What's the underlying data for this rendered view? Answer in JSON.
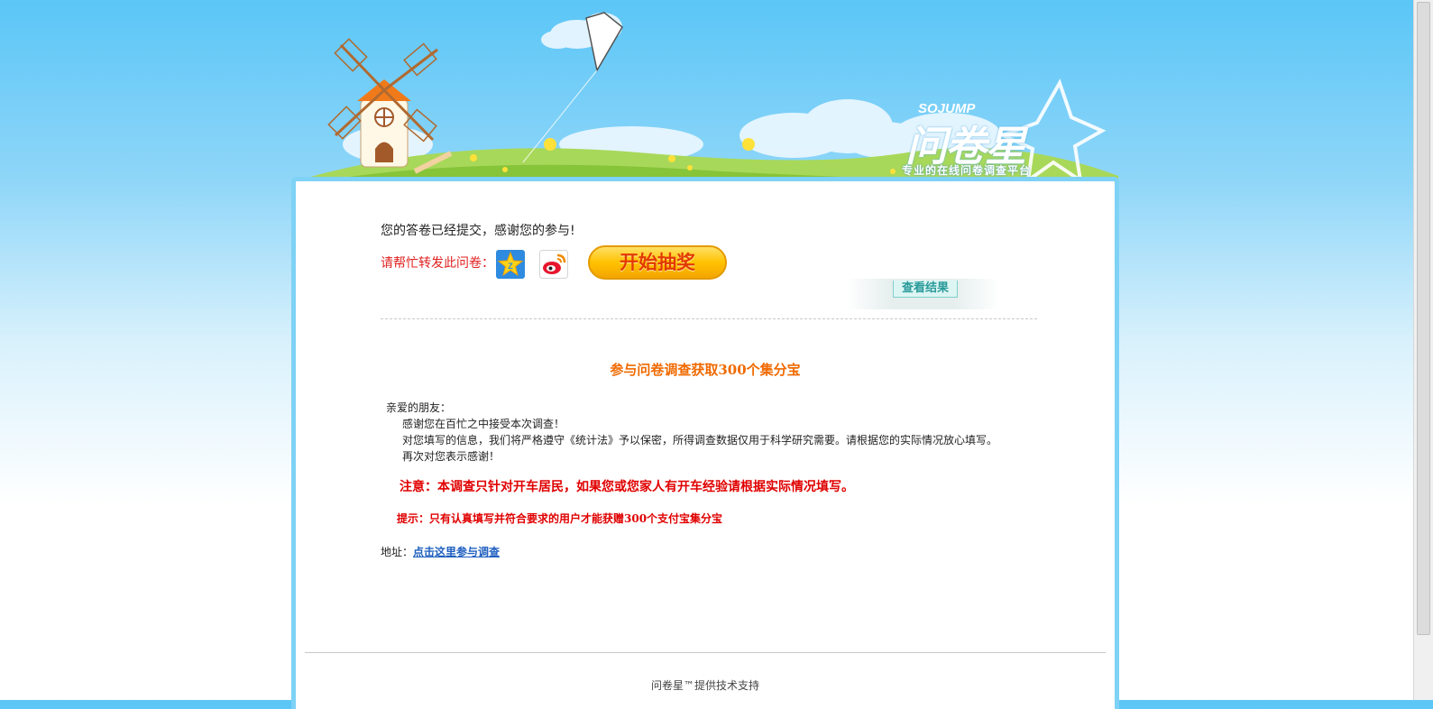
{
  "brand": {
    "logo_latin": "SOJUMP",
    "logo_cn": "问卷星",
    "tagline": "专业的在线问卷调查平台"
  },
  "result": {
    "submitted_message": "您的答卷已经提交，感谢您的参与!",
    "share_label": "请帮忙转发此问卷：",
    "share_icons": [
      "qzone-icon",
      "weibo-icon"
    ],
    "lottery_button": "开始抽奖",
    "view_results": "查看结果"
  },
  "survey": {
    "title": "参与问卷调查获取300个集分宝",
    "greeting": "亲爱的朋友：",
    "lines": [
      "感谢您在百忙之中接受本次调查！",
      "对您填写的信息，我们将严格遵守《统计法》予以保密，所得调查数据仅用于科学研究需要。请根据您的实际情况放心填写。",
      "再次对您表示感谢！"
    ],
    "notice": "注意：本调查只针对开车居民，如果您或您家人有开车经验请根据实际情况填写。",
    "tip": "提示：只有认真填写并符合要求的用户才能获赠300个支付宝集分宝",
    "address_label": "地址：",
    "address_link": "点击这里参与调查"
  },
  "footer": {
    "text": "问卷星™提供技术支持"
  },
  "colors": {
    "sky_top": "#5bc6f7",
    "card_border": "#7ed2f5",
    "accent_red": "#e00000",
    "title_orange": "#f06a00",
    "link_blue": "#1f5fbf"
  }
}
